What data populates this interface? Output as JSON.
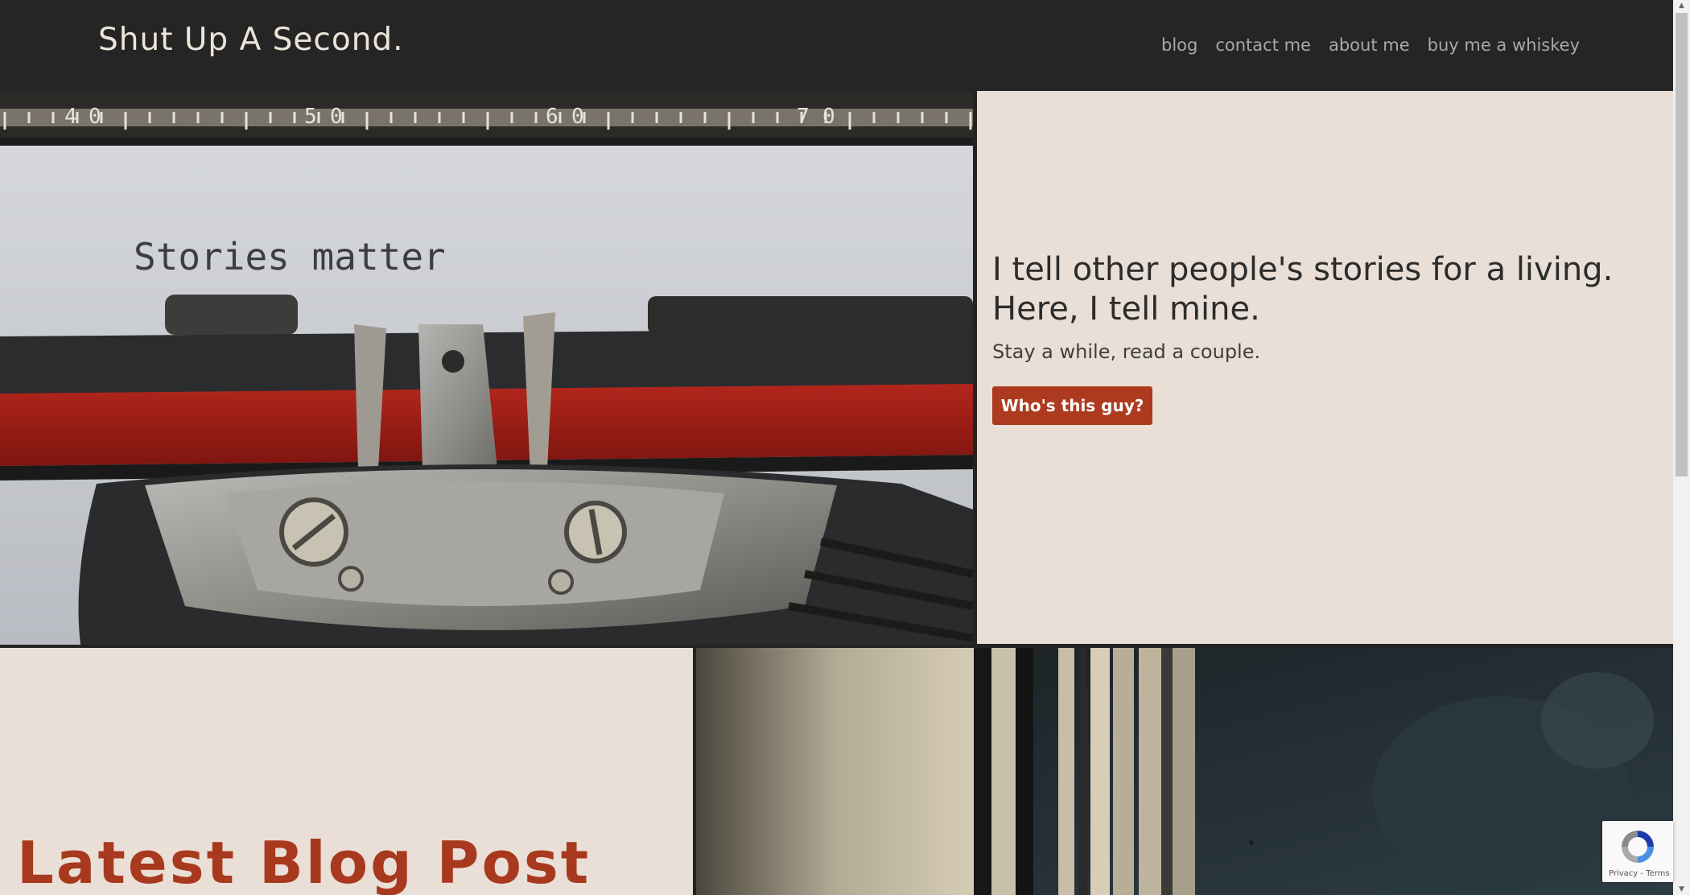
{
  "header": {
    "brand": "Shut Up A Second.",
    "nav": [
      {
        "label": "blog"
      },
      {
        "label": "contact me"
      },
      {
        "label": "about me"
      },
      {
        "label": "buy me a whiskey"
      }
    ]
  },
  "hero": {
    "image_text": "Stories matter",
    "heading_line1": "I tell other people's stories for a living.",
    "heading_line2": "Here, I tell mine.",
    "subheading": "Stay a while, read a couple.",
    "button_label": "Who's this guy?"
  },
  "latest": {
    "title": "Latest Blog Post"
  },
  "recaptcha": {
    "privacy_label": "Privacy",
    "separator": " - ",
    "terms_label": "Terms"
  },
  "colors": {
    "header_bg": "#252525",
    "panel_bg": "#e9dfd6",
    "accent": "#ad3a1f",
    "title_red": "#a8391e"
  }
}
